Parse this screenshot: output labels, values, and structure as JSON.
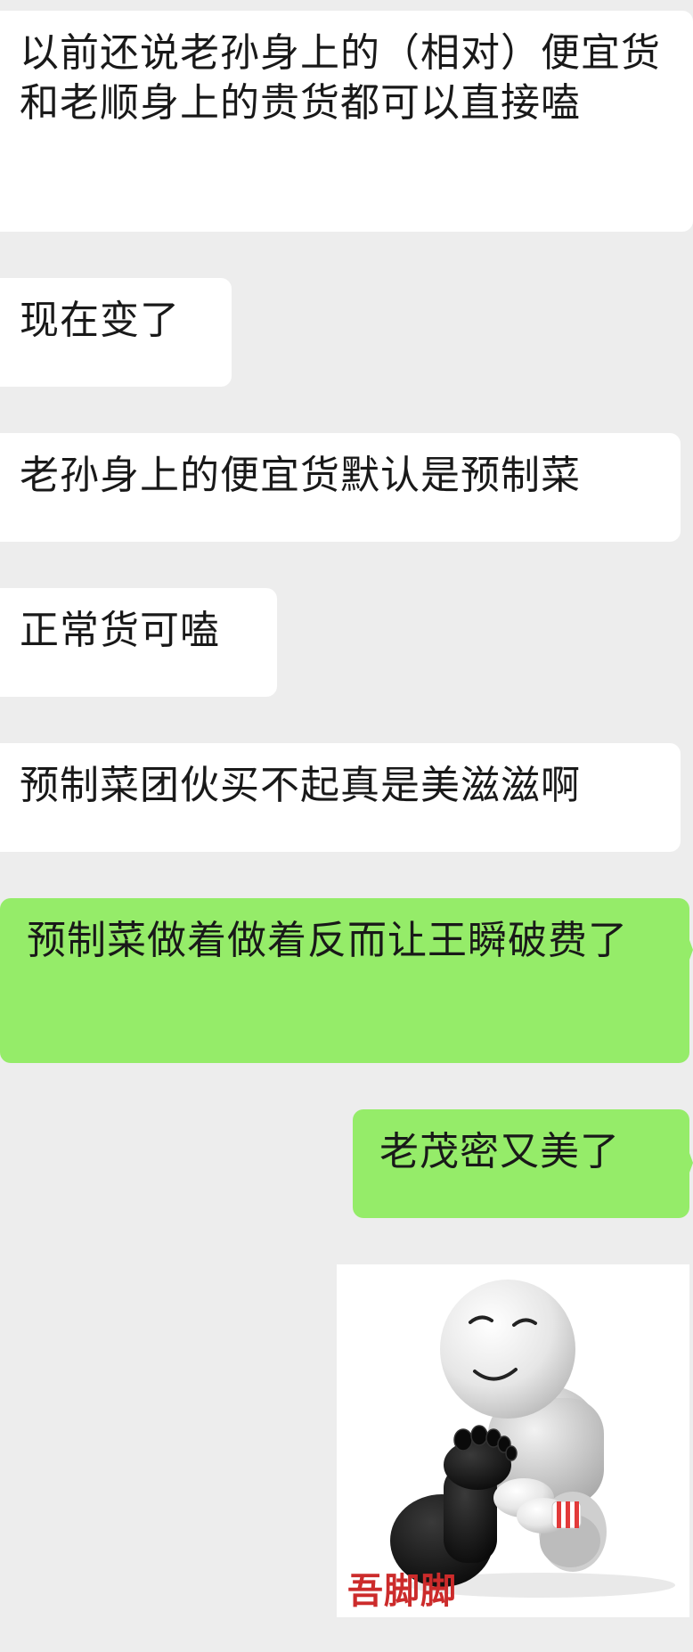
{
  "conversation": {
    "messages": [
      {
        "side": "incoming",
        "text": "以前还说老孙身上的（相对）便宜货和老顺身上的贵货都可以直接嗑"
      },
      {
        "side": "incoming",
        "text": "现在变了"
      },
      {
        "side": "incoming",
        "text": "老孙身上的便宜货默认是预制菜"
      },
      {
        "side": "incoming",
        "text": "正常货可嗑"
      },
      {
        "side": "incoming",
        "text": "预制菜团伙买不起真是美滋滋啊"
      },
      {
        "side": "outgoing",
        "text": "预制菜做着做着反而让王瞬破费了"
      },
      {
        "side": "outgoing",
        "text": "老茂密又美了"
      }
    ],
    "sticker": {
      "caption": "吾脚脚",
      "icon": "cartoon-figure-holding-foot-sticker"
    }
  },
  "colors": {
    "background": "#ededed",
    "incoming_bubble": "#ffffff",
    "outgoing_bubble": "#95ec69",
    "text": "#191919",
    "sticker_caption": "#cc2b2b"
  }
}
